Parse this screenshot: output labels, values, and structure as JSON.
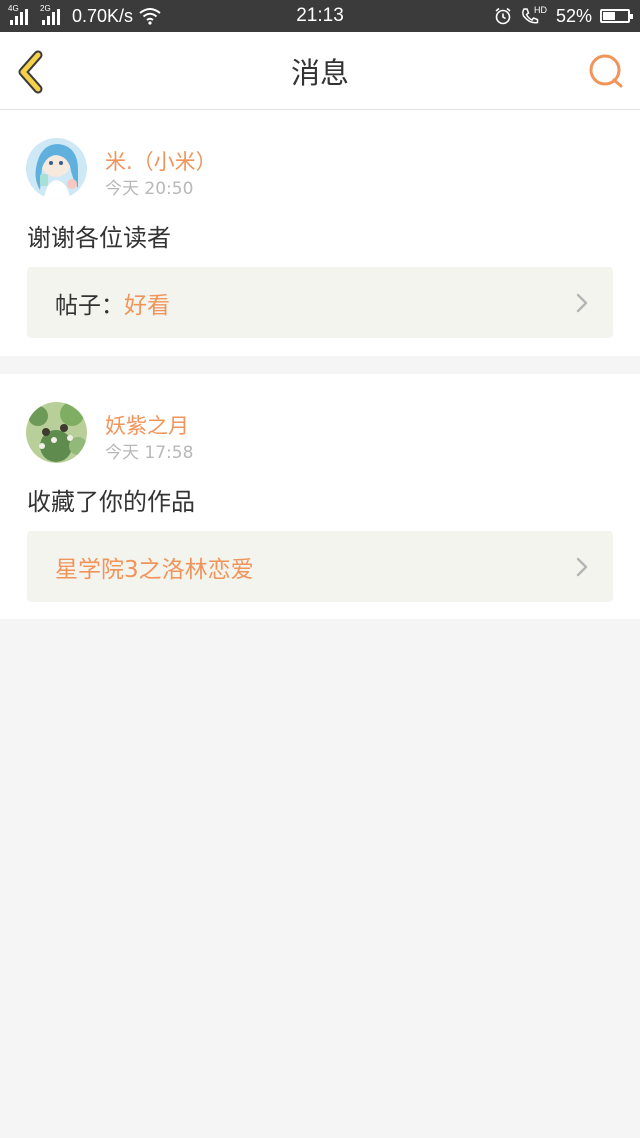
{
  "status_bar": {
    "net1": "4G",
    "net2": "2G",
    "speed": "0.70K/s",
    "time": "21:13",
    "hd": "HD",
    "battery": "52%",
    "battery_level": 0.52
  },
  "header": {
    "title": "消息",
    "back_icon": "chevron-left-icon",
    "search_icon": "search-icon"
  },
  "messages": [
    {
      "user": "米.（小米）",
      "time": "今天 20:50",
      "content": "谢谢各位读者",
      "ref_prefix": "帖子：",
      "ref_title": "好看"
    },
    {
      "user": "妖紫之月",
      "time": "今天 17:58",
      "content": "收藏了你的作品",
      "ref_prefix": "",
      "ref_title": "星学院3之洛林恋爱"
    }
  ],
  "colors": {
    "accent": "#f0945a",
    "back_icon_fill": "#f3d24a",
    "status_bar_bg": "#3b3b3b",
    "page_bg": "#f5f5f5"
  }
}
